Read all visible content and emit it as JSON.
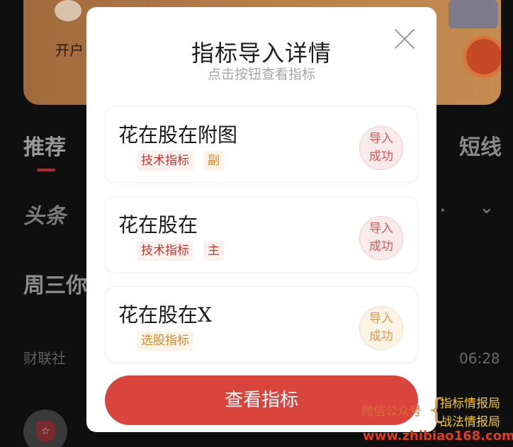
{
  "background": {
    "banner_open_text": "开户",
    "tabs": {
      "recommend": "推荐",
      "short_line": "短线"
    },
    "toutiao_label": "头条",
    "more_dots": "·",
    "headline_partial": "周三你",
    "news_source": "财联社",
    "news_time": "06:28"
  },
  "modal": {
    "title": "指标导入详情",
    "subtitle": "点击按钮查看指标",
    "indicators": [
      {
        "name": "花在股在附图",
        "tags": [
          "技术指标",
          "副"
        ],
        "status_line1": "导入",
        "status_line2": "成功",
        "accent": "#d65a5a"
      },
      {
        "name": "花在股在",
        "tags": [
          "技术指标",
          "主"
        ],
        "status_line1": "导入",
        "status_line2": "成功",
        "accent": "#d65a5a"
      },
      {
        "name": "花在股在X",
        "tags": [
          "选股指标"
        ],
        "status_line1": "导入",
        "status_line2": "成功",
        "accent": "#dc9a4c"
      }
    ],
    "view_button_label": "查看指标"
  },
  "watermark": {
    "label": "微信公众号",
    "line1": "指标情报局",
    "line2": "战法情报局",
    "url": "www.zhibiao168.com"
  },
  "colors": {
    "primary": "#d9453d",
    "success_red": "#d65a5a",
    "success_orange": "#dc9a4c",
    "overlay": "#0f0f10"
  }
}
